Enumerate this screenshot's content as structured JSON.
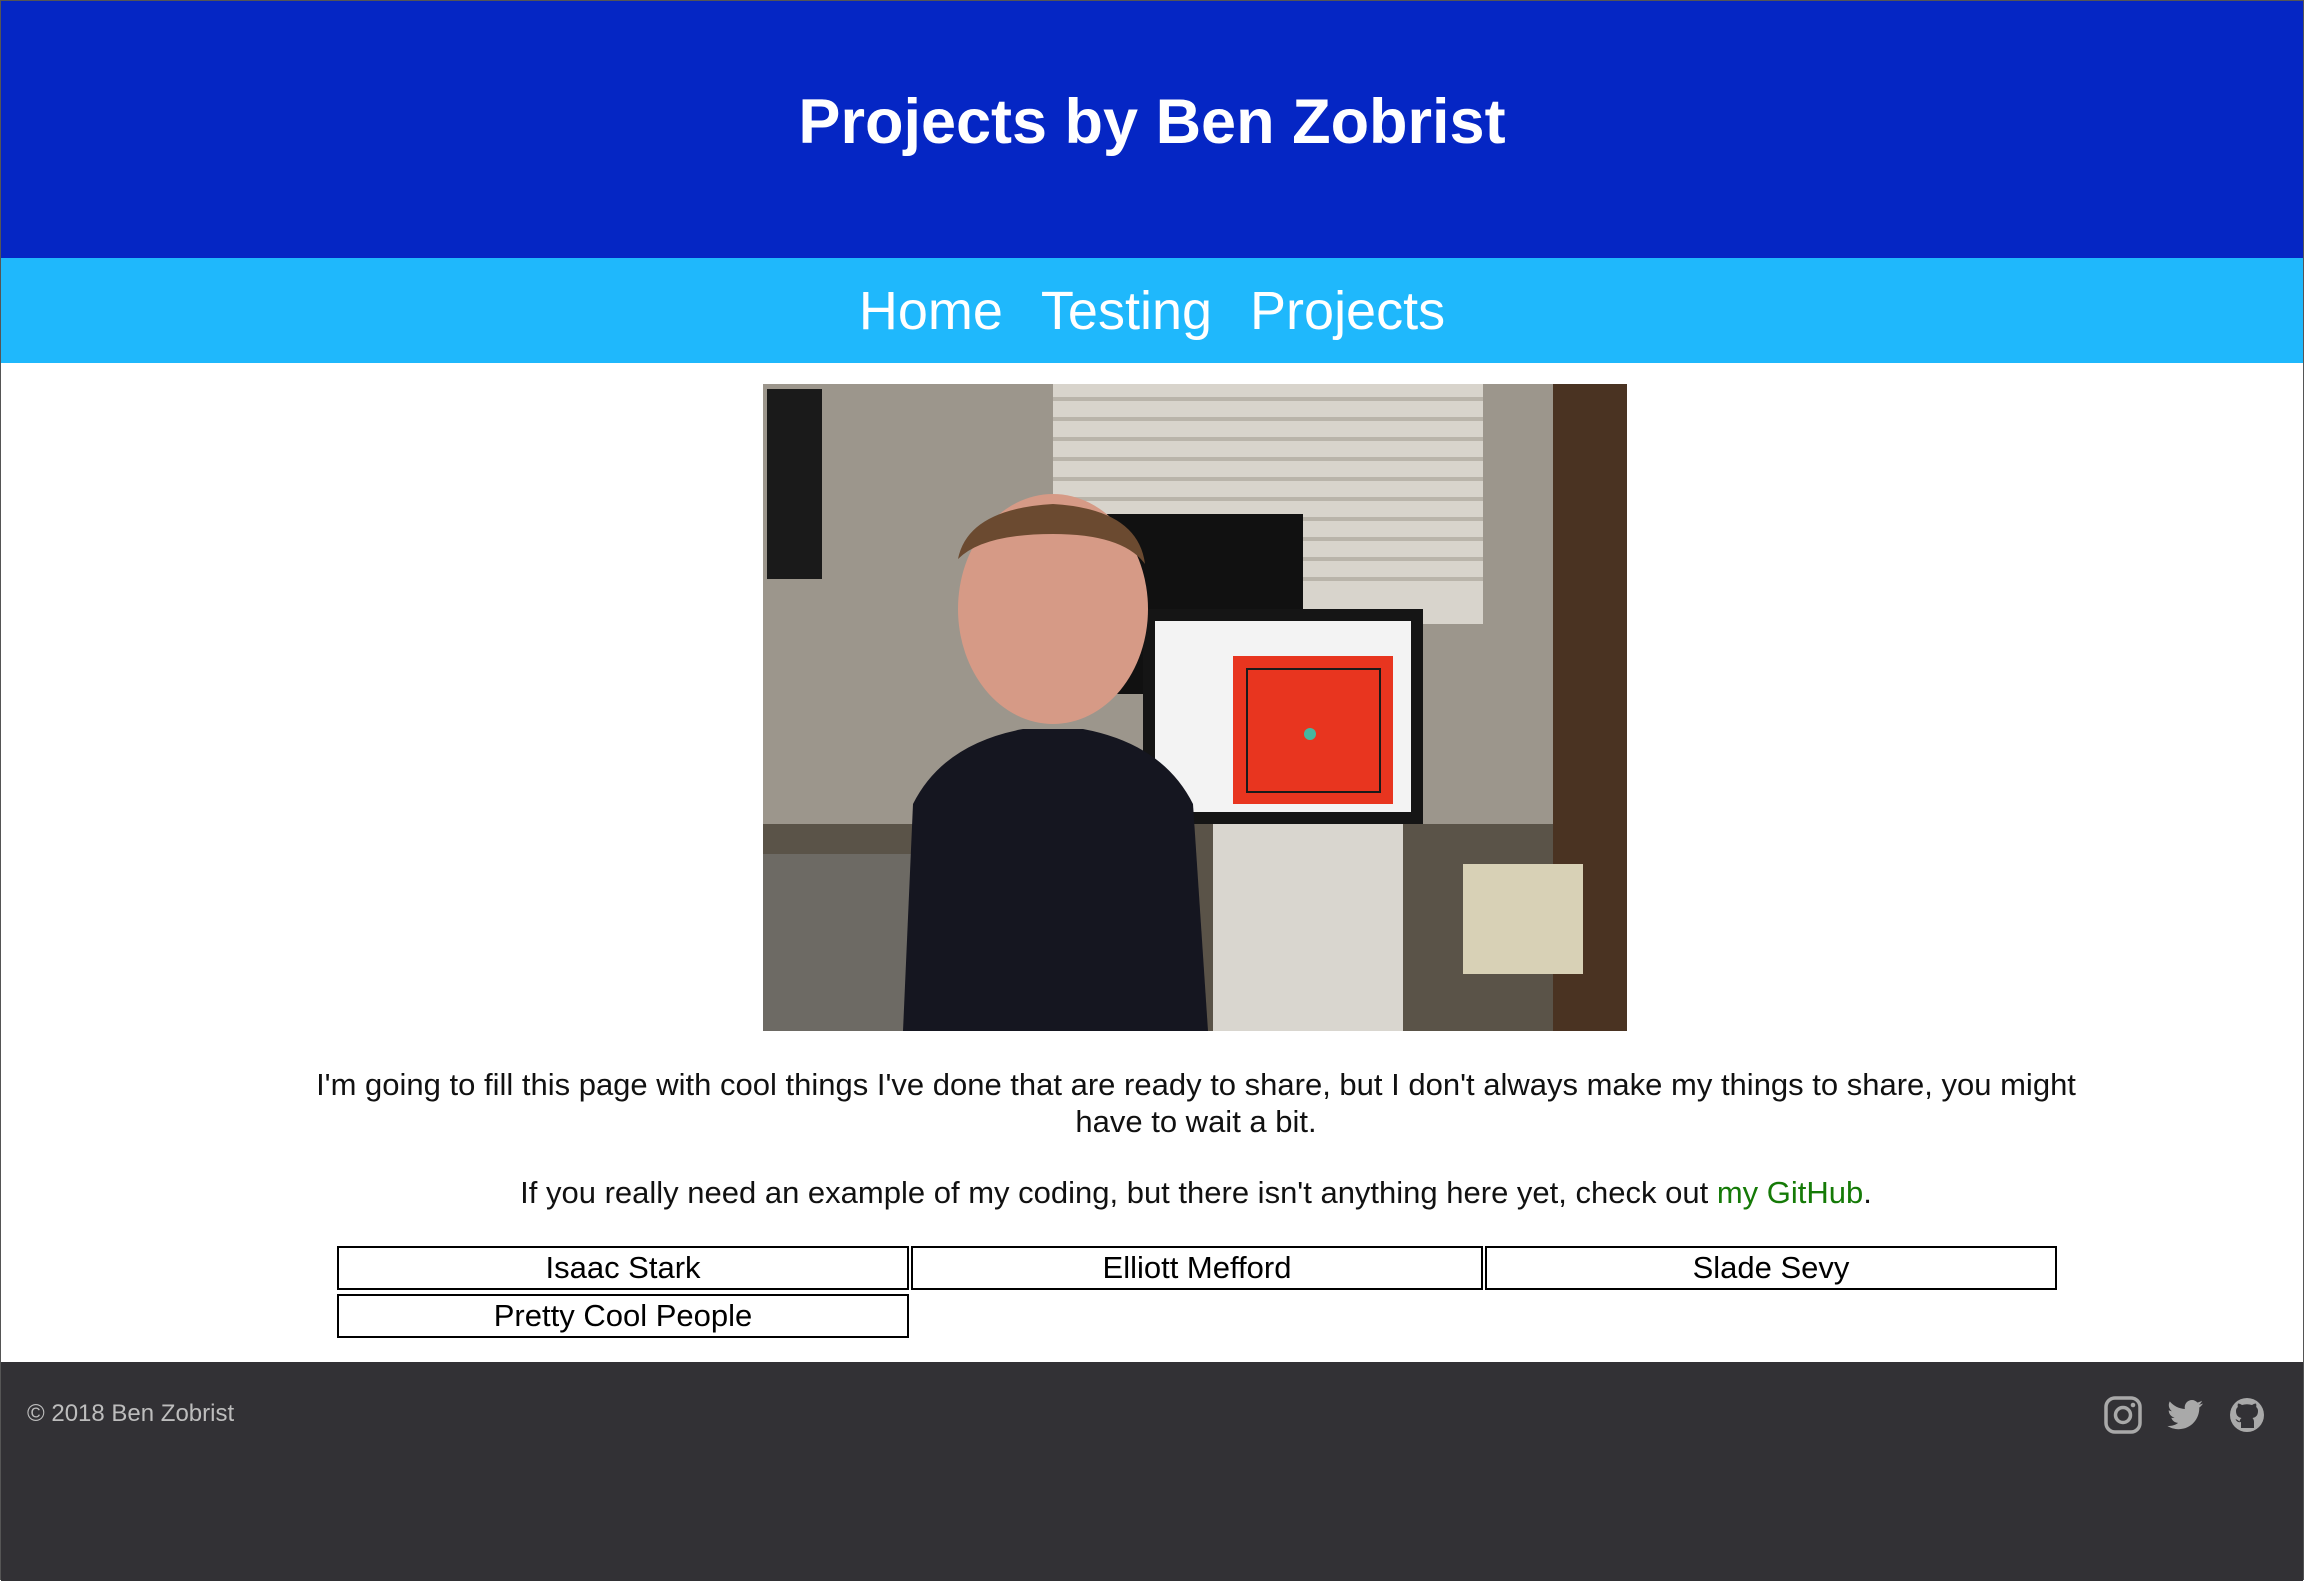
{
  "header": {
    "title": "Projects by Ben Zobrist"
  },
  "nav": {
    "items": [
      {
        "label": "Home"
      },
      {
        "label": "Testing"
      },
      {
        "label": "Projects"
      }
    ]
  },
  "content": {
    "intro": "I'm going to fill this page with cool things I've done that are ready to share, but I don't always make my things to share, you might have to wait a bit.",
    "github_prefix": "If you really need an example of my coding, but there isn't anything here yet, check out ",
    "github_link": "my GitHub",
    "github_suffix": ".",
    "projects": [
      {
        "label": "Isaac Stark"
      },
      {
        "label": "Elliott Mefford"
      },
      {
        "label": "Slade Sevy"
      },
      {
        "label": "Pretty Cool People"
      }
    ]
  },
  "footer": {
    "copyright": "© 2018 Ben Zobrist",
    "social_icons": [
      "instagram-icon",
      "twitter-icon",
      "github-icon"
    ]
  },
  "colors": {
    "header_bg": "#0526c4",
    "nav_bg": "#1fb8fc",
    "footer_bg": "#323135",
    "link": "#157a07"
  }
}
